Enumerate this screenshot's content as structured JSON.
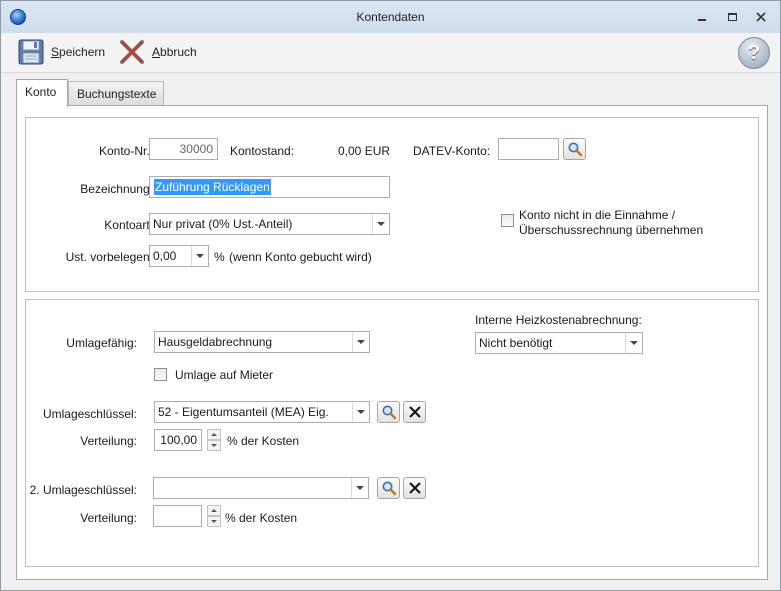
{
  "window": {
    "title": "Kontendaten"
  },
  "toolbar": {
    "save_label_first": "S",
    "save_label_rest": "peichern",
    "abort_label_first": "A",
    "abort_label_rest": "bbruch",
    "help_symbol": "?"
  },
  "tabs": [
    {
      "label": "Konto",
      "active": true
    },
    {
      "label": "Buchungstexte",
      "active": false
    }
  ],
  "konto": {
    "nr_label": "Konto-Nr.:",
    "nr_value": "30000",
    "stand_label": "Kontostand:",
    "stand_value": "0,00 EUR",
    "datev_label": "DATEV-Konto:",
    "datev_value": "",
    "bezeichnung_label": "Bezeichnung:",
    "bezeichnung_value": "Zuführung Rücklagen",
    "kontoart_label": "Kontoart:",
    "kontoart_value": "Nur privat (0% Ust.-Anteil)",
    "ust_label": "Ust. vorbelegen:",
    "ust_value": "0,00",
    "ust_unit": "%",
    "ust_hint": "(wenn Konto gebucht wird)",
    "einnahme_line1": "Konto nicht in die Einnahme /",
    "einnahme_line2": "Überschussrechnung übernehmen",
    "einnahme_checked": false
  },
  "umlage": {
    "faehig_label": "Umlagefähig:",
    "faehig_value": "Hausgeldabrechnung",
    "mieter_label": "Umlage auf Mieter",
    "mieter_checked": false,
    "heiz_label": "Interne Heizkostenabrechnung:",
    "heiz_value": "Nicht benötigt",
    "schluessel_label": "Umlageschlüssel:",
    "schluessel_value": "52 - Eigentumsanteil (MEA) Eig.",
    "verteilung_label": "Verteilung:",
    "verteilung_value": "100,00",
    "verteilung_unit": "% der Kosten",
    "schluessel2_label": "2. Umlageschlüssel:",
    "schluessel2_value": "",
    "verteilung2_label": "Verteilung:",
    "verteilung2_value": "",
    "verteilung2_unit": "% der Kosten"
  },
  "icons": {
    "save": "floppy-disk-icon",
    "abort": "red-x-icon",
    "help": "help-icon",
    "search": "magnifier-icon",
    "clear": "black-x-icon"
  }
}
